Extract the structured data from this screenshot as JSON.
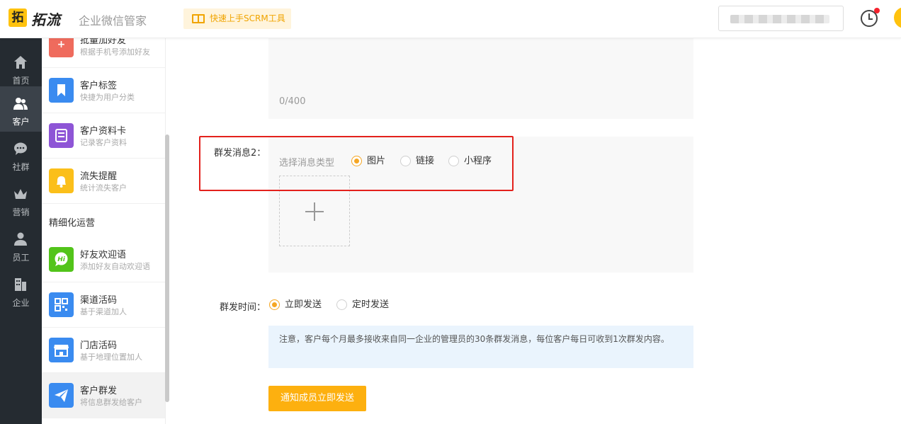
{
  "header": {
    "logo_mark": "拓",
    "logo_text": "拓流",
    "app_name": "企业微信管家",
    "quick_start": "快速上手SCRM工具"
  },
  "leftnav": [
    {
      "label": "首页",
      "icon": "home-icon",
      "active": false
    },
    {
      "label": "客户",
      "icon": "users-icon",
      "active": true
    },
    {
      "label": "社群",
      "icon": "chat-icon",
      "active": false
    },
    {
      "label": "营销",
      "icon": "crown-icon",
      "active": false
    },
    {
      "label": "员工",
      "icon": "person-icon",
      "active": false
    },
    {
      "label": "企业",
      "icon": "building-icon",
      "active": false
    }
  ],
  "submenu": {
    "items": [
      {
        "title": "批量加好友",
        "desc": "根据手机号添加好友",
        "icon": "add-friend-icon",
        "color": "#ef6b5d"
      },
      {
        "title": "客户标签",
        "desc": "快捷为用户分类",
        "icon": "bookmark-icon",
        "color": "#3a8bf0"
      },
      {
        "title": "客户资料卡",
        "desc": "记录客户资料",
        "icon": "profile-card-icon",
        "color": "#8e55d6"
      },
      {
        "title": "流失提醒",
        "desc": "统计流失客户",
        "icon": "bell-icon",
        "color": "#fbbf1a"
      },
      {
        "title": "好友欢迎语",
        "desc": "添加好友自动欢迎语",
        "icon": "hi-icon",
        "color": "#52c41a"
      },
      {
        "title": "渠道活码",
        "desc": "基于渠道加人",
        "icon": "qrcode-icon",
        "color": "#3a8bf0"
      },
      {
        "title": "门店活码",
        "desc": "基于地理位置加人",
        "icon": "store-icon",
        "color": "#3a8bf0"
      },
      {
        "title": "客户群发",
        "desc": "将信息群发给客户",
        "icon": "send-icon",
        "color": "#3a8bf0"
      }
    ],
    "section_title": "精细化运营"
  },
  "form": {
    "counter": "0/400",
    "msg2_label": "群发消息2：",
    "type_label": "选择消息类型",
    "types": [
      "图片",
      "链接",
      "小程序"
    ],
    "selected_type": "图片",
    "time_label": "群发时间：",
    "time_options": [
      "立即发送",
      "定时发送"
    ],
    "selected_time": "立即发送",
    "notice": "注意，客户每个月最多接收来自同一企业的管理员的30条群发消息，每位客户每日可收到1次群发内容。",
    "send_button": "通知成员立即发送"
  }
}
